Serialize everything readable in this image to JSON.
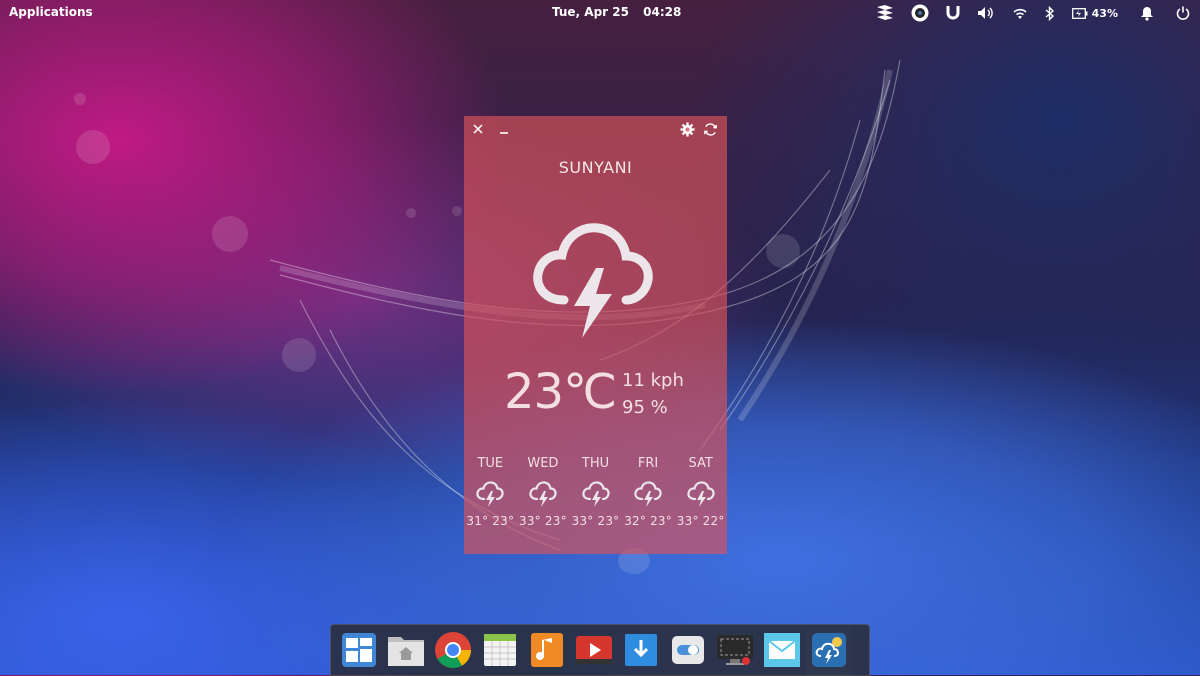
{
  "panel": {
    "applications": "Applications",
    "date": "Tue, Apr 25",
    "time": "04:28",
    "battery_percent": "43%",
    "indicators": [
      "stack-icon",
      "eye-icon",
      "magnet-icon",
      "volume-icon",
      "wifi-icon",
      "bluetooth-icon",
      "battery-icon",
      "notification-bell-icon",
      "power-icon"
    ]
  },
  "weather": {
    "city": "SUNYANI",
    "temperature": "23℃",
    "wind": "11 kph",
    "humidity": "95 %",
    "condition_icon": "thunderstorm-icon",
    "forecast": [
      {
        "day": "TUE",
        "temps": "31° 23°"
      },
      {
        "day": "WED",
        "temps": "33° 23°"
      },
      {
        "day": "THU",
        "temps": "33° 23°"
      },
      {
        "day": "FRI",
        "temps": "32° 23°"
      },
      {
        "day": "SAT",
        "temps": "33° 22°"
      }
    ],
    "accent": "#d6525a"
  },
  "dock": {
    "apps": [
      "multitasking-view-icon",
      "files-icon",
      "chrome-icon",
      "calendar-icon",
      "music-icon",
      "videos-icon",
      "downloads-icon",
      "switchboard-settings-icon",
      "screenshot-icon",
      "mail-icon",
      "weather-app-icon"
    ],
    "active": "weather-app-icon"
  }
}
